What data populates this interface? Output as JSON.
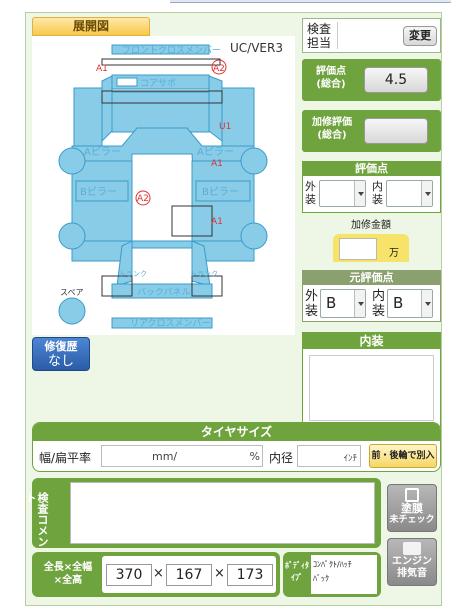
{
  "diagram": {
    "tab_label": "展開図",
    "version": "UC/VER3",
    "parts": {
      "front_cross_member": "フロントクロスメンバー",
      "core_support": "コアサポ",
      "a_pillar_left": "Aピラー",
      "a_pillar_right": "Aピラー",
      "b_pillar_left": "Bピラー",
      "b_pillar_right": "Bピラー",
      "back_panel": "バックパネル",
      "rear_cross_member": "リアクロスメンバー",
      "spare": "スペア",
      "trunk_left": "トランク",
      "trunk_right": "トランク"
    },
    "damage_marks": {
      "front_left": "A1",
      "front_right": "A2",
      "u1": "U1",
      "right_a1_upper": "A1",
      "right_a1_lower": "A1",
      "center": "A2"
    }
  },
  "repair_history": {
    "title": "修復歴",
    "value": "なし"
  },
  "inspector": {
    "label_line1": "検査",
    "label_line2": "担当",
    "change_button": "変更"
  },
  "overall_score": {
    "label_line1": "評価点",
    "label_line2": "(総合)",
    "value": "4.5"
  },
  "repair_score": {
    "label_line1": "加修評価",
    "label_line2": "(総合)",
    "value": ""
  },
  "evaluation": {
    "title": "評価点",
    "exterior_label_1": "外",
    "exterior_label_2": "装",
    "exterior_value": "",
    "interior_label_1": "内",
    "interior_label_2": "装",
    "interior_value": ""
  },
  "repair_cost": {
    "label": "加修金額",
    "value": "",
    "unit": "万"
  },
  "original_evaluation": {
    "title": "元評価点",
    "exterior_label_1": "外",
    "exterior_label_2": "装",
    "exterior_value": "B",
    "interior_label_1": "内",
    "interior_label_2": "装",
    "interior_value": "B"
  },
  "interior": {
    "title": "内装",
    "value": ""
  },
  "tire": {
    "title": "タイヤサイズ",
    "width_label": "幅/扁平率",
    "mm_unit": "mm/",
    "percent_unit": "%",
    "inner_label": "内径",
    "inch_unit": "ｲﾝﾁ",
    "separate_button": "前・後輪で別入力"
  },
  "comment": {
    "label": "検査コメント",
    "value": ""
  },
  "paint_button": {
    "line1": "塗膜",
    "line2": "未チェック"
  },
  "engine_button": {
    "line1": "エンジン",
    "line2": "排気音"
  },
  "dimensions": {
    "label_line1": "全長×全幅",
    "label_line2": "×全高",
    "length": "370",
    "width": "167",
    "height": "173",
    "times": "×"
  },
  "body_type": {
    "label_line1": "ﾎﾞﾃﾞｨﾀ",
    "label_line2": "ｲﾌﾟ",
    "value_line1": "ｺﾝﾊﾟｸﾄ/ﾊｯﾁ",
    "value_line2": "ﾊﾞｯｸ"
  },
  "colors": {
    "green": "#6fa33e",
    "part_fill": "#88cce8",
    "part_stroke": "#3a9bc9",
    "mark_red": "#e03030",
    "repair_blue": "#2f65b5"
  }
}
